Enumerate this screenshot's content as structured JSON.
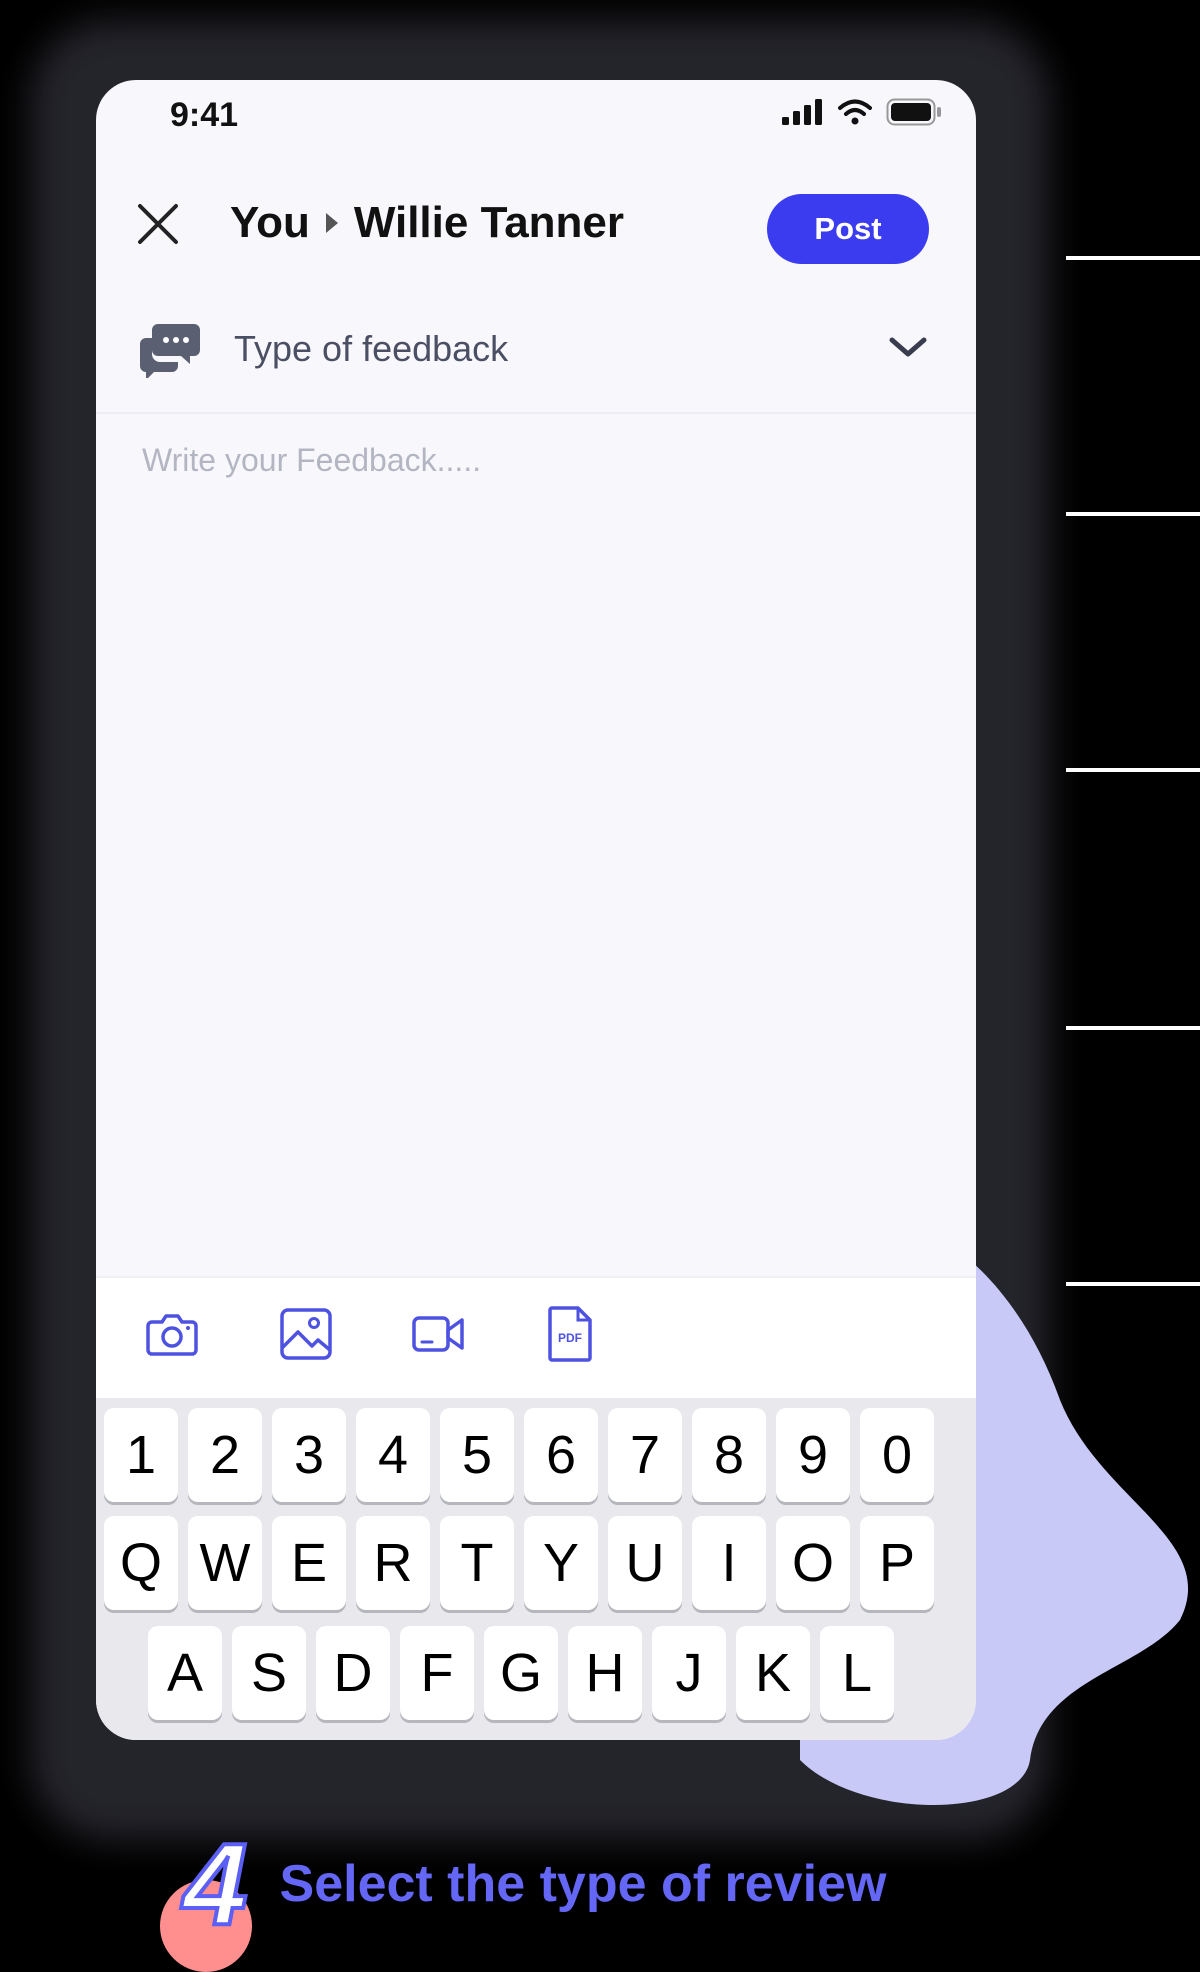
{
  "status": {
    "time": "9:41"
  },
  "header": {
    "from": "You",
    "to": "Willie Tanner",
    "post_label": "Post"
  },
  "feedback_type": {
    "label": "Type of feedback"
  },
  "feedback_input": {
    "placeholder": "Write your Feedback....."
  },
  "keyboard": {
    "row1": [
      "1",
      "2",
      "3",
      "4",
      "5",
      "6",
      "7",
      "8",
      "9",
      "0"
    ],
    "row2": [
      "Q",
      "W",
      "E",
      "R",
      "T",
      "Y",
      "U",
      "I",
      "O",
      "P"
    ],
    "row3": [
      "A",
      "S",
      "D",
      "F",
      "G",
      "H",
      "J",
      "K",
      "L"
    ]
  },
  "caption": {
    "step": "4",
    "text": "Select the type of review"
  },
  "colors": {
    "accent": "#3b3cf0",
    "icon": "#4e52e0",
    "caption": "#6466f6",
    "blob": "#c9c9f7"
  },
  "icons": [
    "close-icon",
    "feedback-chat-icon",
    "chevron-down-icon",
    "camera-icon",
    "image-icon",
    "video-icon",
    "pdf-icon"
  ]
}
